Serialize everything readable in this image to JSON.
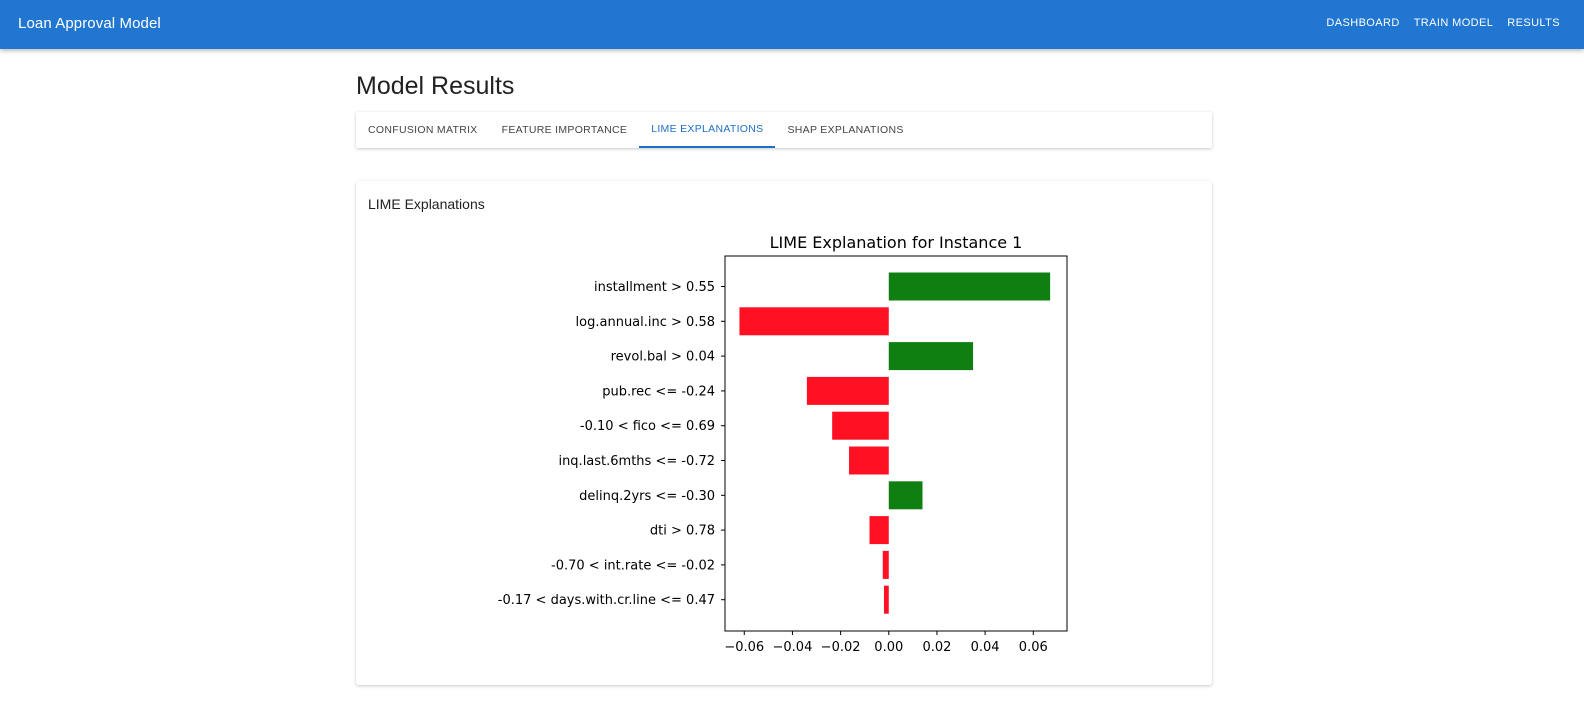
{
  "appbar": {
    "title": "Loan Approval Model",
    "nav": [
      "DASHBOARD",
      "TRAIN MODEL",
      "RESULTS"
    ]
  },
  "page": {
    "title": "Model Results"
  },
  "tabs": [
    {
      "label": "CONFUSION MATRIX",
      "active": false
    },
    {
      "label": "FEATURE IMPORTANCE",
      "active": false
    },
    {
      "label": "LIME EXPLANATIONS",
      "active": true
    },
    {
      "label": "SHAP EXPLANATIONS",
      "active": false
    }
  ],
  "card": {
    "title": "LIME Explanations"
  },
  "colors": {
    "appbar": "#2176d2",
    "active_tab": "#1e6fc8",
    "positive_bar": "#0f7f12",
    "negative_bar": "#ff1023"
  },
  "chart_data": {
    "type": "bar",
    "orientation": "horizontal",
    "title": "LIME Explanation for Instance 1",
    "xlabel": "",
    "ylabel": "",
    "xlim": [
      -0.068,
      0.074
    ],
    "xticks": [
      -0.06,
      -0.04,
      -0.02,
      0.0,
      0.02,
      0.04,
      0.06
    ],
    "xtick_labels": [
      "−0.06",
      "−0.04",
      "−0.02",
      "0.00",
      "0.02",
      "0.04",
      "0.06"
    ],
    "grid": false,
    "categories": [
      "installment > 0.55",
      "log.annual.inc > 0.58",
      "revol.bal > 0.04",
      "pub.rec <= -0.24",
      "-0.10 < fico <= 0.69",
      "inq.last.6mths <= -0.72",
      "delinq.2yrs <= -0.30",
      "dti > 0.78",
      "-0.70 < int.rate <= -0.02",
      "-0.17 < days.with.cr.line <= 0.47"
    ],
    "values": [
      0.067,
      -0.062,
      0.035,
      -0.034,
      -0.0235,
      -0.0165,
      0.014,
      -0.008,
      -0.0025,
      -0.002
    ]
  }
}
